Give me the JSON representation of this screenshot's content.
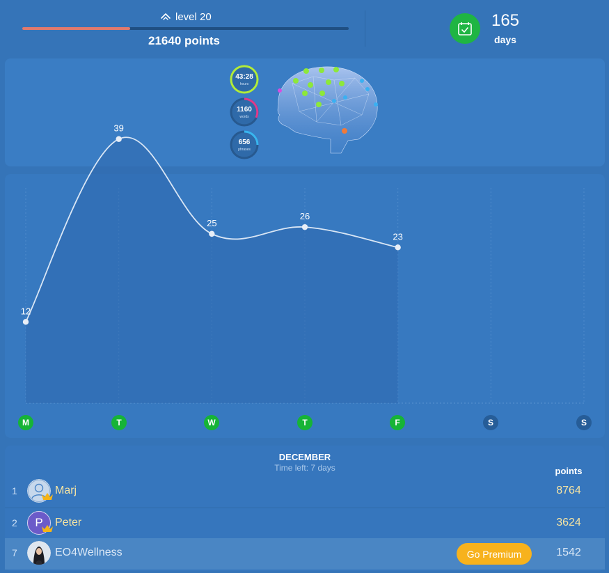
{
  "header": {
    "level_label": "level 20",
    "level_progress": 0.33,
    "points_label": "21640 points",
    "streak_count": "165",
    "streak_unit": "days"
  },
  "stats": {
    "hours": {
      "value": "43:28",
      "label": "hours",
      "color": "#b2ec3a"
    },
    "words": {
      "value": "1160",
      "label": "words",
      "color": "#e03a8a"
    },
    "phrases": {
      "value": "656",
      "label": "phrases",
      "color": "#39b6f0"
    }
  },
  "chart_data": {
    "type": "line",
    "categories": [
      "M",
      "T",
      "W",
      "T",
      "F",
      "S",
      "S"
    ],
    "values": [
      12,
      39,
      25,
      26,
      23,
      null,
      null
    ],
    "completed": [
      true,
      true,
      true,
      true,
      true,
      false,
      false
    ],
    "ylim": [
      0,
      40
    ],
    "grid": "vertical dashed",
    "colors": {
      "line": "#d9e6f5",
      "done": "#16b436",
      "todo": "#265d98"
    }
  },
  "leaderboard": {
    "month": "DECEMBER",
    "time_left": "Time left: 7 days",
    "points_header": "points",
    "rows": [
      {
        "rank": "1",
        "name": "Marj",
        "points": "8764",
        "avatar": "person-placeholder"
      },
      {
        "rank": "2",
        "name": "Peter",
        "points": "3624",
        "avatar": "P"
      },
      {
        "rank": "7",
        "name": "EO4Wellness",
        "points": "1542",
        "avatar": "photo"
      }
    ],
    "premium_button": "Go Premium"
  }
}
